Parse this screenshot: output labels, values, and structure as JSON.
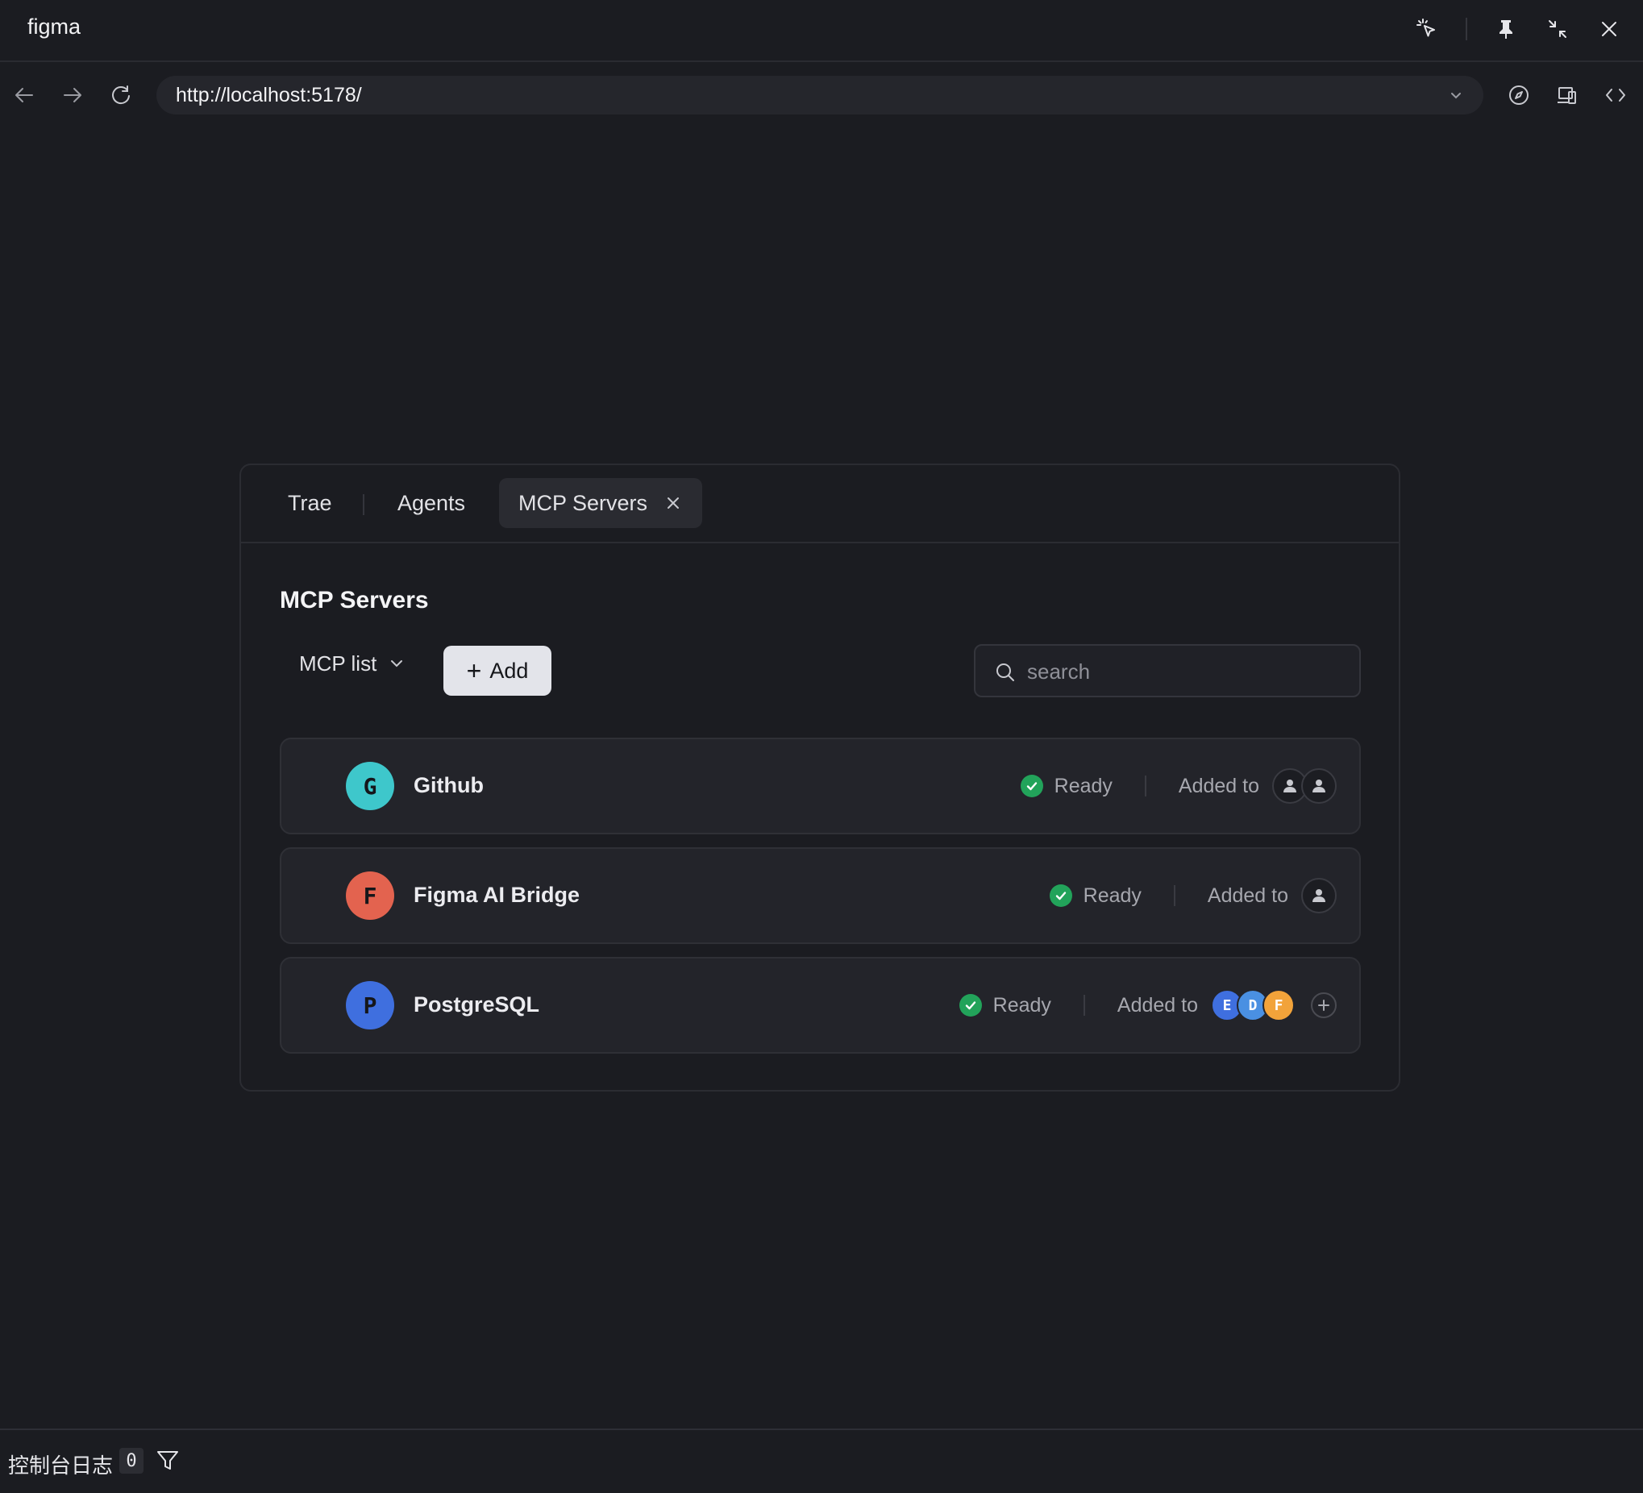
{
  "window": {
    "title": "figma",
    "controls": [
      "pointer-sparkle-icon",
      "pin-icon",
      "collapse-icon",
      "close-icon"
    ]
  },
  "browser": {
    "url": "http://localhost:5178/",
    "nav": [
      "back-arrow-icon",
      "forward-arrow-icon",
      "reload-icon"
    ],
    "tools": [
      "compass-icon",
      "responsive-device-icon",
      "code-icon"
    ]
  },
  "tabs": [
    {
      "label": "Trae",
      "active": false
    },
    {
      "label": "Agents",
      "active": false
    },
    {
      "label": "MCP Servers",
      "active": true
    }
  ],
  "panel": {
    "title": "MCP Servers",
    "dropdown_label": "MCP list",
    "add_label": "Add",
    "search_placeholder": "search"
  },
  "servers": [
    {
      "initial": "G",
      "name": "Github",
      "avatar_color": "#3ec7cb",
      "status": "Ready",
      "added_label": "Added to",
      "added_users": [
        "user-icon",
        "user-icon"
      ]
    },
    {
      "initial": "F",
      "name": "Figma AI Bridge",
      "avatar_color": "#e3634f",
      "status": "Ready",
      "added_label": "Added to",
      "added_users": [
        "user-icon"
      ]
    },
    {
      "initial": "P",
      "name": "PostgreSQL",
      "avatar_color": "#3f6fdf",
      "status": "Ready",
      "added_label": "Added to",
      "added_agents": [
        {
          "letter": "E",
          "color": "#3f6fdf"
        },
        {
          "letter": "D",
          "color": "#4a90e2"
        },
        {
          "letter": "F",
          "color": "#f2a33a"
        }
      ]
    }
  ],
  "colors": {
    "ready": "#22a35a",
    "background": "#1b1c21",
    "row_background": "#23242a"
  },
  "console": {
    "label": "控制台日志",
    "count": "0"
  }
}
